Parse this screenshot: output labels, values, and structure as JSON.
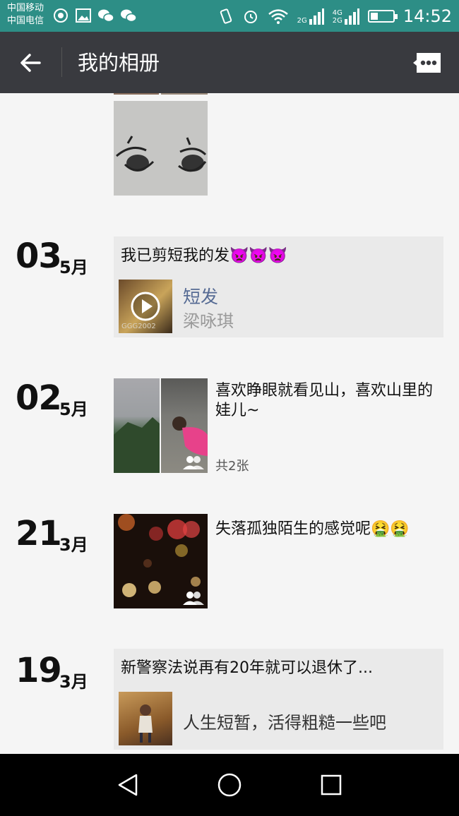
{
  "status_bar": {
    "carrier_1": "中国移动",
    "carrier_2": "中国电信",
    "net_1": "2G",
    "net_2a": "4G",
    "net_2b": "2G",
    "time": "14:52"
  },
  "header": {
    "back_icon": "arrow-left-icon",
    "title": "我的相册",
    "message_icon": "chat-bubble-icon"
  },
  "posts": [
    {
      "day": "03",
      "month": "5月",
      "text": "我已剪短我的发",
      "emoji": "👿👿👿",
      "link": {
        "title": "短发",
        "subtitle": "梁咏琪",
        "thumb_text": "GGG2002"
      }
    },
    {
      "day": "02",
      "month": "5月",
      "text": "喜欢睁眼就看见山，喜欢山里的娃儿~",
      "count": "共2张"
    },
    {
      "day": "21",
      "month": "3月",
      "text": "失落孤独陌生的感觉呢",
      "emoji": "🤮🤮"
    },
    {
      "day": "19",
      "month": "3月",
      "text": "新警察法说再有20年就可以退休了...",
      "link": {
        "subtitle": "人生短暂，活得粗糙一些吧"
      }
    }
  ],
  "nav": {
    "back": "triangle-back-icon",
    "home": "circle-home-icon",
    "recent": "square-recents-icon"
  },
  "colors": {
    "status_bar": "#2d8e86",
    "action_bar": "#393a3f",
    "background": "#f5f5f5",
    "link_title": "#566b94"
  }
}
